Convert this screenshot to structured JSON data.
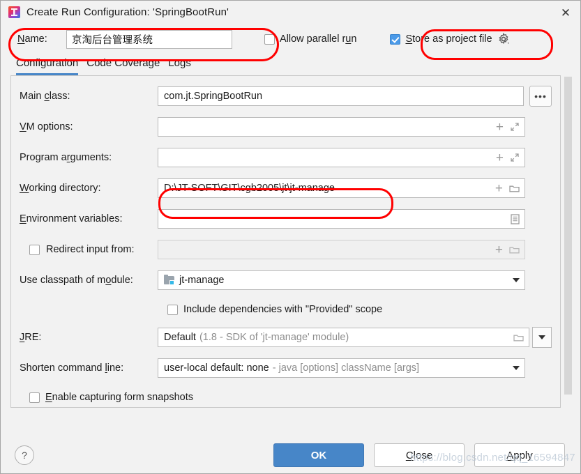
{
  "window": {
    "title": "Create Run Configuration: 'SpringBootRun'",
    "icon": "intellij-idea-icon",
    "close_label": "✕"
  },
  "name_row": {
    "label": "Name:",
    "label_mnemonic": "N",
    "value": "京淘后台管理系统",
    "allow_parallel": {
      "label_pre": "Allow parallel r",
      "label_mn": "u",
      "label_post": "n",
      "checked": false
    },
    "store_as_project_file": {
      "label_mn": "S",
      "label_post": "tore as project file",
      "checked": true
    },
    "gear_icon": "gear-icon"
  },
  "tabs": [
    {
      "label": "Configuration",
      "active": true
    },
    {
      "label": "Code Coverage",
      "active": false
    },
    {
      "label": "Logs",
      "active": false
    }
  ],
  "form": {
    "main_class": {
      "label_pre": "Main ",
      "label_mn": "c",
      "label_post": "lass:",
      "value": "com.jt.SpringBootRun",
      "browse_label": "•••"
    },
    "vm_options": {
      "label_mn": "V",
      "label_post": "M options:",
      "value": "",
      "icons": [
        "plus-icon",
        "expand-icon"
      ]
    },
    "program_arguments": {
      "label_pre": "Program a",
      "label_mn": "r",
      "label_post": "guments:",
      "value": "",
      "icons": [
        "plus-icon",
        "expand-icon"
      ]
    },
    "working_directory": {
      "label_mn": "W",
      "label_post": "orking directory:",
      "value": "D:\\JT-SOFT\\GIT\\cgb2005\\jt\\jt-manage",
      "icons": [
        "plus-icon",
        "folder-icon"
      ]
    },
    "environment_variables": {
      "label_mn": "E",
      "label_post": "nvironment variables:",
      "value": "",
      "icons": [
        "list-icon"
      ]
    },
    "redirect_input": {
      "label": "Redirect input from:",
      "checked": false,
      "value": "",
      "disabled": true,
      "icons": [
        "plus-icon",
        "folder-icon"
      ]
    },
    "use_classpath_of_module": {
      "label_pre": "Use classpath of m",
      "label_mn": "o",
      "label_post": "dule:",
      "value": "jt-manage",
      "icon": "module-icon"
    },
    "include_provided": {
      "label": "Include dependencies with \"Provided\" scope",
      "checked": false
    },
    "jre": {
      "label_mn": "J",
      "label_post": "RE:",
      "value_strong": "Default",
      "value_dim": "(1.8 - SDK of 'jt-manage' module)",
      "icons": [
        "folder-icon"
      ]
    },
    "shorten_command_line": {
      "label_pre": "Shorten command ",
      "label_mn": "l",
      "label_post": "ine:",
      "value_strong": "user-local default: none",
      "value_dim": "- java [options] className [args]"
    },
    "enable_capturing": {
      "label_mn": "E",
      "label_post": "nable capturing form snapshots",
      "checked": false
    }
  },
  "footer": {
    "help_label": "?",
    "ok": {
      "label": "OK"
    },
    "close": {
      "label_mn": "C",
      "label_post": "lose"
    },
    "apply": {
      "label_mn": "A",
      "label_post": "pply"
    }
  },
  "watermark": "https://blog.csdn.net/qq_16594847",
  "colors": {
    "accent": "#4786c8",
    "checkbox_checked": "#4b9ae8",
    "annotation_ring": "#ff0000",
    "dialog_bg": "#f2f2f2"
  }
}
